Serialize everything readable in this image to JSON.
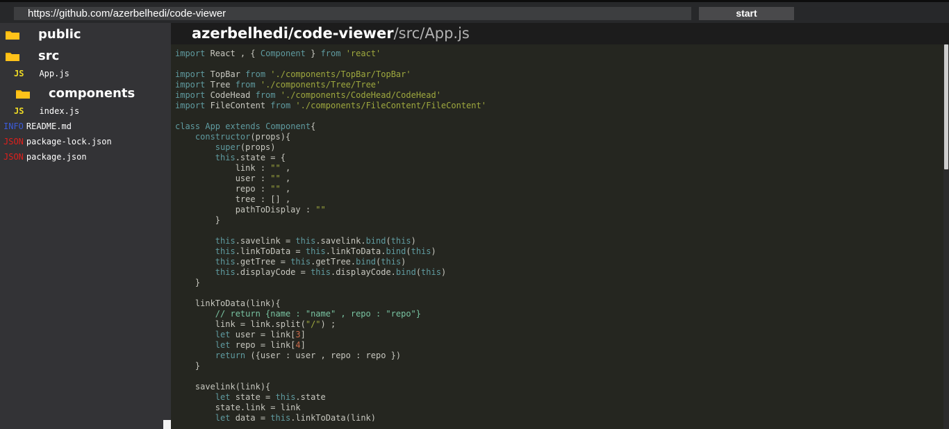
{
  "topbar": {
    "url": "https://github.com/azerbelhedi/code-viewer",
    "start_label": "start"
  },
  "sidebar": {
    "items": [
      {
        "kind": "folder",
        "label": "public",
        "icon": "folder-icon"
      },
      {
        "kind": "folder",
        "label": "src",
        "icon": "folder-icon"
      },
      {
        "kind": "file",
        "badge": "JS",
        "label": "App.js"
      },
      {
        "kind": "folder",
        "label": "components",
        "icon": "folder-icon"
      },
      {
        "kind": "file",
        "badge": "JS",
        "label": "index.js"
      },
      {
        "kind": "file",
        "badge": "INFO",
        "label": "README.md"
      },
      {
        "kind": "file",
        "badge": "JSON",
        "label": "package-lock.json"
      },
      {
        "kind": "file",
        "badge": "JSON",
        "label": "package.json"
      }
    ]
  },
  "code_head": {
    "repo": "azerbelhedi/code-viewer",
    "file_path": "/src/App.js"
  },
  "colors": {
    "folder": "#f5b400",
    "badge_js": "#f0db24",
    "badge_info": "#3b5bdb",
    "badge_json": "#e0201c",
    "keyword": "#5f9ba0",
    "string": "#9fa93e",
    "code_bg": "#252620"
  },
  "code": {
    "lines": [
      "import React , { Component } from 'react'",
      "",
      "import TopBar from './components/TopBar/TopBar'",
      "import Tree from './components/Tree/Tree'",
      "import CodeHead from './components/CodeHead/CodeHead'",
      "import FileContent from './components/FileContent/FileContent'",
      "",
      "class App extends Component{",
      "    constructor(props){",
      "        super(props)",
      "        this.state = {",
      "            link : \"\" ,",
      "            user : \"\" ,",
      "            repo : \"\" ,",
      "            tree : [] ,",
      "            pathToDisplay : \"\"",
      "        }",
      "",
      "        this.savelink = this.savelink.bind(this)",
      "        this.linkToData = this.linkToData.bind(this)",
      "        this.getTree = this.getTree.bind(this)",
      "        this.displayCode = this.displayCode.bind(this)",
      "    }",
      "",
      "    linkToData(link){",
      "        // return {name : \"name\" , repo : \"repo\"}",
      "        link = link.split(\"/\") ;",
      "        let user = link[3]",
      "        let repo = link[4]",
      "        return ({user : user , repo : repo })",
      "    }",
      "",
      "    savelink(link){",
      "        let state = this.state",
      "        state.link = link",
      "        let data = this.linkToData(link)"
    ]
  }
}
